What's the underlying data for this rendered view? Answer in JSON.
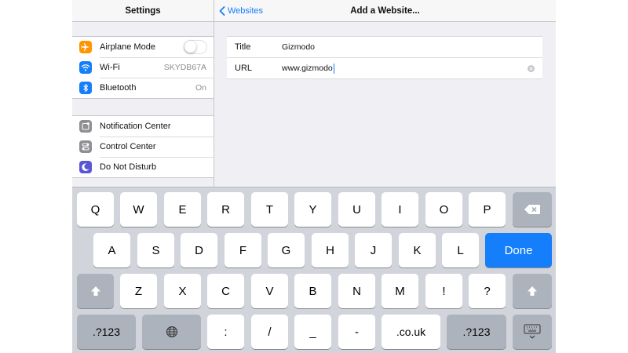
{
  "settings": {
    "title": "Settings",
    "group1": [
      {
        "label": "Airplane Mode",
        "icon": "airplane-icon",
        "color": "#ff9500",
        "type": "toggle",
        "on": false
      },
      {
        "label": "Wi-Fi",
        "icon": "wifi-icon",
        "color": "#147efb",
        "value": "SKYDB67A"
      },
      {
        "label": "Bluetooth",
        "icon": "bluetooth-icon",
        "color": "#147efb",
        "value": "On"
      }
    ],
    "group2": [
      {
        "label": "Notification Center",
        "icon": "notification-center-icon",
        "color": "#8e8e93"
      },
      {
        "label": "Control Center",
        "icon": "control-center-icon",
        "color": "#8e8e93"
      },
      {
        "label": "Do Not Disturb",
        "icon": "moon-icon",
        "color": "#5856d6"
      }
    ]
  },
  "detail": {
    "back_label": "Websites",
    "title": "Add a Website...",
    "fields": {
      "title_label": "Title",
      "title_value": "Gizmodo",
      "url_label": "URL",
      "url_value": "www.gizmodo"
    }
  },
  "keyboard": {
    "row1": [
      "Q",
      "W",
      "E",
      "R",
      "T",
      "Y",
      "U",
      "I",
      "O",
      "P"
    ],
    "row2": [
      "A",
      "S",
      "D",
      "F",
      "G",
      "H",
      "J",
      "K",
      "L"
    ],
    "row3": [
      "Z",
      "X",
      "C",
      "V",
      "B",
      "N",
      "M",
      "!",
      "?"
    ],
    "row4": [
      ".?123",
      ":",
      "/",
      "_",
      "-",
      ".co.uk",
      ".?123"
    ],
    "done": "Done",
    "return_color": "#147efb",
    "icons": [
      "backspace-icon",
      "shift-icon",
      "globe-icon",
      "keyboard-dismiss-icon"
    ]
  },
  "colors": {
    "accent": "#147efb",
    "background": "#efeff4",
    "keyboard": "#d1d5db"
  }
}
